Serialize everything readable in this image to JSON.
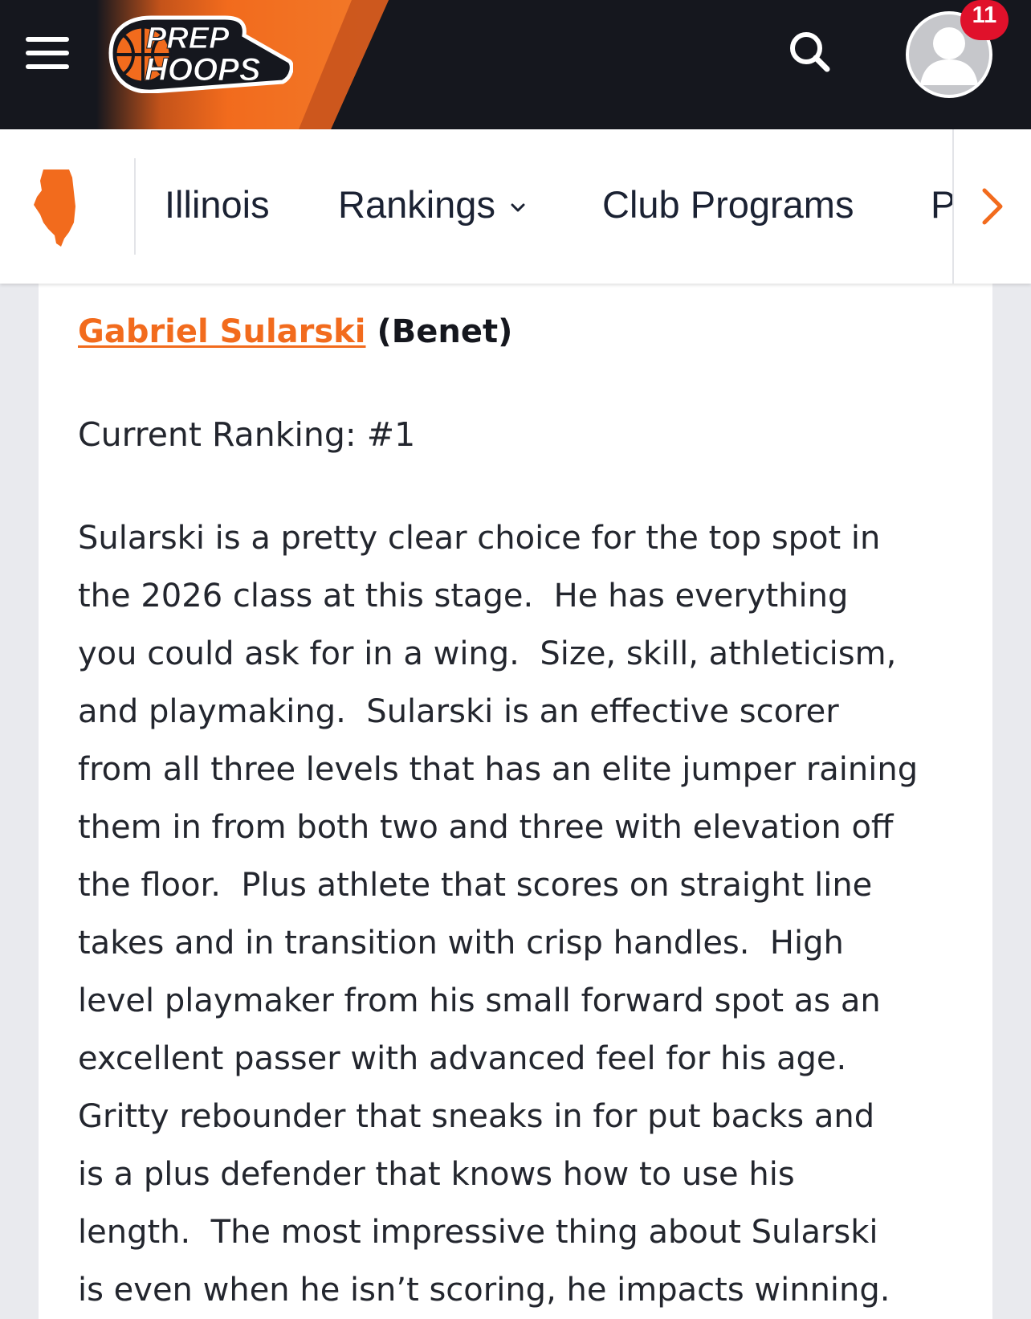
{
  "header": {
    "logo_line1": "PREP",
    "logo_line2": "HOOPS",
    "notification_count": "11",
    "brand_orange": "#f26b1d",
    "bar_color": "#15171e"
  },
  "nav": {
    "state_icon": "illinois-state-icon",
    "items": [
      {
        "label": "Illinois"
      },
      {
        "label": "Rankings"
      },
      {
        "label": "Club Programs"
      },
      {
        "label": "P"
      }
    ]
  },
  "article": {
    "player_name": "Gabriel Sularski",
    "school": "(Benet)",
    "ranking": "Current Ranking: #1",
    "lines": [
      "Sularski is a pretty clear choice for the top spot in",
      "the 2026 class at this stage.  He has everything",
      "you could ask for in a wing.  Size, skill, athleticism,",
      "and playmaking.  Sularski is an effective scorer",
      "from all three levels that has an elite jumper raining",
      "them in from both two and three with elevation off",
      "the floor.  Plus athlete that scores on straight line",
      "takes and in transition with crisp handles.  High",
      "level playmaker from his small forward spot as an",
      "excellent passer with advanced feel for his age.",
      "Gritty rebounder that sneaks in for put backs and",
      "is a plus defender that knows how to use his",
      "length.  The most impressive thing about Sularski",
      "is even when he isn’t scoring, he impacts winning."
    ]
  }
}
